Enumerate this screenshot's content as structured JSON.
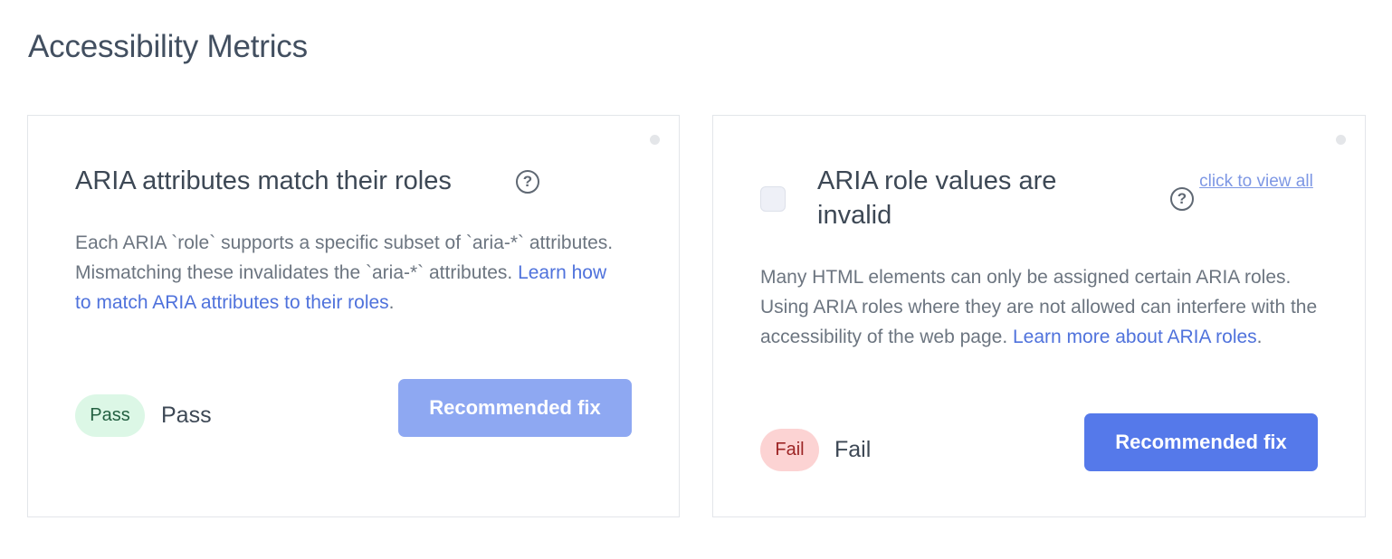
{
  "page": {
    "title": "Accessibility Metrics"
  },
  "colors": {
    "link": "#4f72dc",
    "primary_button": "#5579ea",
    "primary_button_disabled": "#8ea8f2",
    "pass_bg": "#dcf7e6",
    "pass_text": "#236041",
    "fail_bg": "#fcd3d3",
    "fail_text": "#9c2525"
  },
  "cards": [
    {
      "title": "ARIA attributes match their roles",
      "help_icon": "question-circle-icon",
      "description": "Each ARIA `role` supports a specific subset of `aria-*` attributes. Mismatching these invalidates the `aria-*` attributes.",
      "link_text": "Learn how to match ARIA attributes to their roles",
      "description_suffix": ".",
      "badge": "Pass",
      "status": "Pass",
      "button_label": "Recommended fix",
      "button_disabled": true
    },
    {
      "title": "ARIA role values are invalid",
      "help_icon": "question-circle-icon",
      "view_all_label": "click to view all",
      "checkbox_checked": false,
      "description": "Many HTML elements can only be assigned certain ARIA roles. Using ARIA roles where they are not allowed can interfere with the accessibility of the web page.",
      "link_text": "Learn more about ARIA roles",
      "description_suffix": ".",
      "badge": "Fail",
      "status": "Fail",
      "button_label": "Recommended fix",
      "button_disabled": false
    }
  ]
}
